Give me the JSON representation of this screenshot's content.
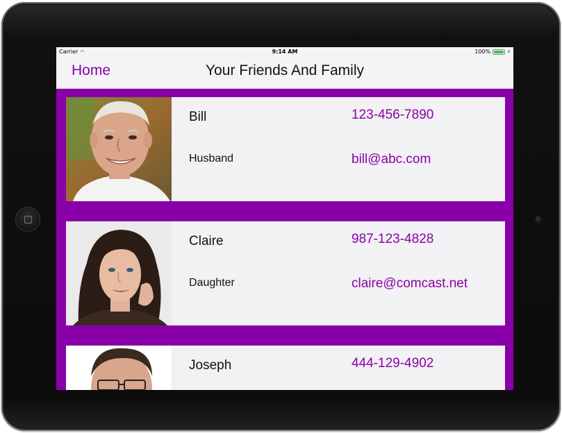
{
  "status_bar": {
    "carrier": "Carrier",
    "time": "9:14 AM",
    "battery": "100%"
  },
  "nav": {
    "back_label": "Home",
    "title": "Your Friends And Family"
  },
  "colors": {
    "accent": "#8a00a8",
    "card_bg": "#f2f1f3",
    "bar_bg": "#f4f4f6"
  },
  "contacts": [
    {
      "name": "Bill",
      "relation": "Husband",
      "phone": "123-456-7890",
      "email": "bill@abc.com",
      "photo_icon": "older-man-photo"
    },
    {
      "name": "Claire",
      "relation": "Daughter",
      "phone": "987-123-4828",
      "email": "claire@comcast.net",
      "photo_icon": "woman-photo"
    },
    {
      "name": "Joseph",
      "relation": "",
      "phone": "444-129-4902",
      "email": "",
      "photo_icon": "man-photo"
    }
  ]
}
